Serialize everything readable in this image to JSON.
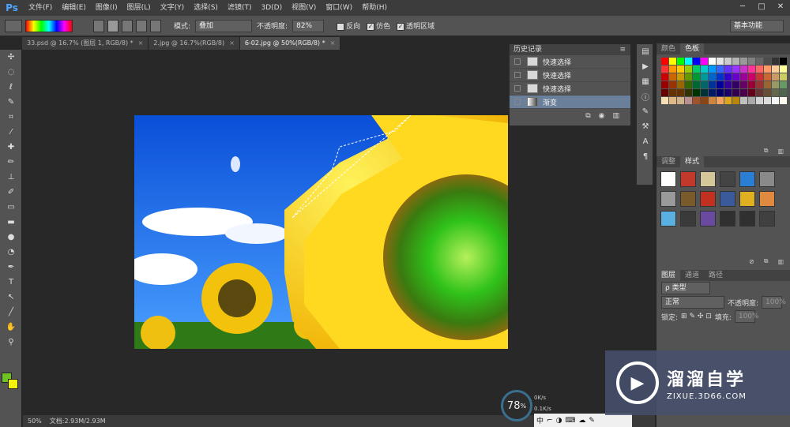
{
  "menubar": {
    "logo": "Ps",
    "items": [
      "文件(F)",
      "编辑(E)",
      "图像(I)",
      "图层(L)",
      "文字(Y)",
      "选择(S)",
      "滤镜(T)",
      "3D(D)",
      "视图(V)",
      "窗口(W)",
      "帮助(H)"
    ],
    "window_controls": [
      "─",
      "□",
      "✕"
    ]
  },
  "options": {
    "mode_label": "模式:",
    "mode_value": "叠加",
    "opacity_label": "不透明度:",
    "opacity_value": "82%",
    "reverse": "反向",
    "dither": "仿色",
    "transparency": "透明区域",
    "workspace": "基本功能"
  },
  "tabs": [
    {
      "label": "33.psd @ 16.7% (图层 1, RGB/8) *",
      "close": "×"
    },
    {
      "label": "2.jpg @ 16.7%(RGB/8)",
      "close": "×"
    },
    {
      "label": "6-02.jpg @ 50%(RGB/8) *",
      "close": "×"
    }
  ],
  "toolbar": {
    "tools": [
      "move-icon",
      "marquee-icon",
      "lasso-icon",
      "quick-select-icon",
      "crop-icon",
      "eyedropper-icon",
      "healing-icon",
      "brush-icon",
      "stamp-icon",
      "history-brush-icon",
      "eraser-icon",
      "gradient-icon",
      "blur-icon",
      "dodge-icon",
      "pen-icon",
      "type-icon",
      "path-select-icon",
      "shape-icon",
      "hand-icon",
      "zoom-icon"
    ],
    "glyphs": [
      "✣",
      "◌",
      "ℓ",
      "✎",
      "⌗",
      "⁄",
      "✚",
      "✏",
      "⊥",
      "✐",
      "▭",
      "▬",
      "●",
      "◔",
      "✒",
      "T",
      "↖",
      "╱",
      "✋",
      "⚲"
    ],
    "fg": "#6ec224",
    "bg": "#f2f20a"
  },
  "status": {
    "zoom": "50%",
    "doc": "文档:2.93M/2.93M"
  },
  "history": {
    "title": "历史记录",
    "rows": [
      "快速选择",
      "快速选择",
      "快速选择",
      "渐变"
    ],
    "foot_icons": [
      "new-doc-icon",
      "camera-icon",
      "trash-icon"
    ]
  },
  "right": {
    "swatch_tabs": [
      "颜色",
      "色板"
    ],
    "style_tabs": [
      "调整",
      "样式"
    ],
    "layer_tabs": [
      "图层",
      "通道",
      "路径"
    ],
    "layer_kind": "ρ 类型",
    "blend": "正常",
    "opacity_label": "不透明度:",
    "opacity_value": "100%",
    "lock_label": "锁定:",
    "fill_label": "填充:",
    "fill_value": "100%"
  },
  "swatches": [
    "#ff0000",
    "#ffff00",
    "#00ff00",
    "#00ffff",
    "#0000ff",
    "#ff00ff",
    "#ffffff",
    "#e6e6e6",
    "#cccccc",
    "#b3b3b3",
    "#999999",
    "#808080",
    "#666666",
    "#4d4d4d",
    "#333333",
    "#000000",
    "#ff3333",
    "#ff9900",
    "#ffcc00",
    "#99cc00",
    "#00cc66",
    "#00cccc",
    "#0099ff",
    "#3366ff",
    "#6633ff",
    "#9933ff",
    "#cc33cc",
    "#ff3399",
    "#ff6666",
    "#ff9966",
    "#ffcc99",
    "#ffff99",
    "#cc0000",
    "#cc6600",
    "#cc9900",
    "#669900",
    "#009933",
    "#009999",
    "#0066cc",
    "#0033cc",
    "#3300cc",
    "#6600cc",
    "#990099",
    "#cc0066",
    "#cc3333",
    "#cc6633",
    "#cc9966",
    "#cccc66",
    "#990000",
    "#993300",
    "#996600",
    "#336600",
    "#006633",
    "#006666",
    "#003399",
    "#000099",
    "#330099",
    "#330066",
    "#660066",
    "#990033",
    "#993333",
    "#996633",
    "#999966",
    "#669966",
    "#660000",
    "#663300",
    "#663300",
    "#333300",
    "#003300",
    "#003333",
    "#001a66",
    "#000066",
    "#1a0066",
    "#33004d",
    "#4d004d",
    "#66001a",
    "#663333",
    "#664d33",
    "#66664d",
    "#4d664d",
    "#f5deb3",
    "#deb887",
    "#d2b48c",
    "#bc8f8f",
    "#a0522d",
    "#8b4513",
    "#cd853f",
    "#f4a460",
    "#daa520",
    "#b8860b",
    "#c0c0c0",
    "#a9a9a9",
    "#d3d3d3",
    "#dcdcdc",
    "#f5f5f5",
    "#fffaf0"
  ],
  "styles": [
    "#ffffff",
    "#c0392b",
    "#d4c89a",
    "#444444",
    "#2a7fd4",
    "#8a8a8a",
    "#9a9a9a",
    "#7a5a2a",
    "#c23020",
    "#3a5a9a",
    "#e0b020",
    "#e08a40",
    "#5ab0e0",
    "#3a3a3a",
    "#6a4aa0",
    "#303030",
    "#303030",
    "#404040"
  ],
  "speed": {
    "value": "78",
    "unit": "%"
  },
  "net": {
    "up": "0K/s",
    "down": "0.1K/s"
  },
  "taskbar": [
    "中",
    "⌐",
    "◑",
    "⌨",
    "☁",
    "✎"
  ],
  "watermark": {
    "title": "溜溜自学",
    "url": "ZIXUE.3D66.COM"
  }
}
